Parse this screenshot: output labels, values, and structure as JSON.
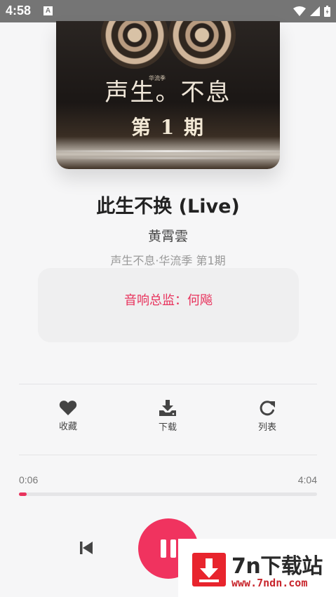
{
  "status_bar": {
    "time": "4:58",
    "notification": "A"
  },
  "cover": {
    "show_title": "声生。不息",
    "show_sub": "华流季",
    "episode": "第 1 期"
  },
  "song": {
    "title": "此生不换 (Live)",
    "artist": "黄霄雲",
    "album": "声生不息·华流季 第1期"
  },
  "credit": "音响总监：何飚",
  "actions": [
    {
      "icon": "heart-icon",
      "label": "收藏"
    },
    {
      "icon": "download-icon",
      "label": "下载"
    },
    {
      "icon": "repeat-icon",
      "label": "列表"
    }
  ],
  "player": {
    "current_time": "0:06",
    "total_time": "4:04",
    "progress_percent": 2.5
  },
  "watermark": {
    "brand": "7n下载站",
    "url": "www.7ndn.com"
  },
  "colors": {
    "accent": "#f0335f",
    "status_bar": "#757575"
  }
}
